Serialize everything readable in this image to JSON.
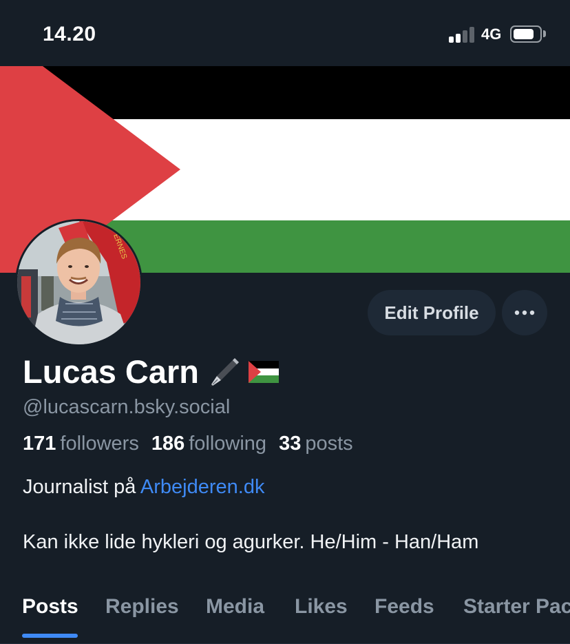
{
  "status_bar": {
    "time": "14.20",
    "network": "4G",
    "signal_bars": 2,
    "signal_bars_total": 4,
    "battery_level": 0.8
  },
  "banner": {
    "flag": "Palestinian flag",
    "colors": {
      "black": "#000000",
      "white": "#ffffff",
      "green": "#3f9441",
      "red": "#de4044"
    }
  },
  "profile": {
    "display_name": "Lucas Carn",
    "name_emoji_1": "pen-nib-icon",
    "name_emoji_2": "palestine-flag-icon",
    "handle": "@lucascarn.bsky.social",
    "stats": {
      "followers_count": "171",
      "followers_label": "followers",
      "following_count": "186",
      "following_label": "following",
      "posts_count": "33",
      "posts_label": "posts"
    },
    "bio": {
      "line1_prefix": "Journalist på ",
      "line1_link": "Arbejderen.dk",
      "line2": "Kan ikke lide hykleri og agurker. He/Him - Han/Ham"
    }
  },
  "actions": {
    "edit_label": "Edit Profile",
    "more_label": "···"
  },
  "tabs": [
    {
      "label": "Posts",
      "active": true
    },
    {
      "label": "Replies",
      "active": false
    },
    {
      "label": "Media",
      "active": false
    },
    {
      "label": "Likes",
      "active": false
    },
    {
      "label": "Feeds",
      "active": false
    },
    {
      "label": "Starter Packs",
      "active": false
    }
  ],
  "theme": {
    "background": "#161e27",
    "accent": "#3f8af5",
    "muted_text": "#8a96a3",
    "button_bg": "#1e2936"
  }
}
